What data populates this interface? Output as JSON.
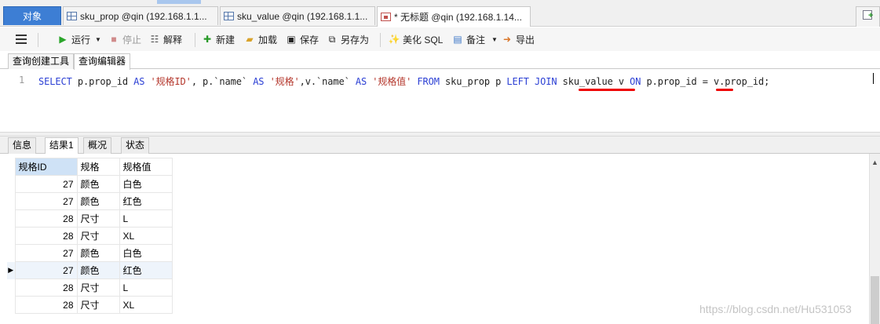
{
  "tabs": [
    {
      "label": "对象",
      "icon": "objects"
    },
    {
      "label": "sku_prop @qin (192.168.1.1...",
      "icon": "table-grid-icon"
    },
    {
      "label": "sku_value @qin (192.168.1.1...",
      "icon": "table-grid-icon"
    },
    {
      "label": "* 无标题 @qin (192.168.1.14...",
      "icon": "query-icon"
    }
  ],
  "toolbar": {
    "run": "运行",
    "stop": "停止",
    "explain": "解释",
    "new": "新建",
    "load": "加载",
    "save": "保存",
    "save_as": "另存为",
    "beautify": "美化 SQL",
    "notes": "备注",
    "export": "导出"
  },
  "subtabs": [
    "查询创建工具",
    "查询编辑器"
  ],
  "editor": {
    "line_number": "1",
    "tokens": [
      {
        "t": "SELECT",
        "c": "kw"
      },
      {
        "t": " p.prop_id ",
        "c": "plain"
      },
      {
        "t": "AS",
        "c": "kw"
      },
      {
        "t": " ",
        "c": "plain"
      },
      {
        "t": "'规格ID'",
        "c": "str"
      },
      {
        "t": ", p.`name` ",
        "c": "plain"
      },
      {
        "t": "AS",
        "c": "kw"
      },
      {
        "t": " ",
        "c": "plain"
      },
      {
        "t": "'规格'",
        "c": "str"
      },
      {
        "t": ",v.`name` ",
        "c": "plain"
      },
      {
        "t": "AS",
        "c": "kw"
      },
      {
        "t": " ",
        "c": "plain"
      },
      {
        "t": "'规格值'",
        "c": "str"
      },
      {
        "t": " ",
        "c": "plain"
      },
      {
        "t": "FROM",
        "c": "kw"
      },
      {
        "t": " sku_prop p ",
        "c": "plain"
      },
      {
        "t": "LEFT JOIN",
        "c": "kw"
      },
      {
        "t": " sku_value v ",
        "c": "plain"
      },
      {
        "t": "ON",
        "c": "kw"
      },
      {
        "t": " p.prop_id = v.prop_id;",
        "c": "plain"
      }
    ]
  },
  "result_tabs": [
    "信息",
    "结果1",
    "概况",
    "状态"
  ],
  "result": {
    "columns": [
      "规格ID",
      "规格",
      "规格值"
    ],
    "rows": [
      [
        "27",
        "颜色",
        "白色"
      ],
      [
        "27",
        "颜色",
        "红色"
      ],
      [
        "28",
        "尺寸",
        "L"
      ],
      [
        "28",
        "尺寸",
        "XL"
      ],
      [
        "27",
        "颜色",
        "白色"
      ],
      [
        "27",
        "颜色",
        "红色"
      ],
      [
        "28",
        "尺寸",
        "L"
      ],
      [
        "28",
        "尺寸",
        "XL"
      ]
    ],
    "current_row": 5
  },
  "watermark": "https://blog.csdn.net/Hu531053",
  "colors": {
    "keyword": "#2b3fd4",
    "string": "#b4372c",
    "underline": "#e00000",
    "objects_tab": "#3d7ed4"
  }
}
